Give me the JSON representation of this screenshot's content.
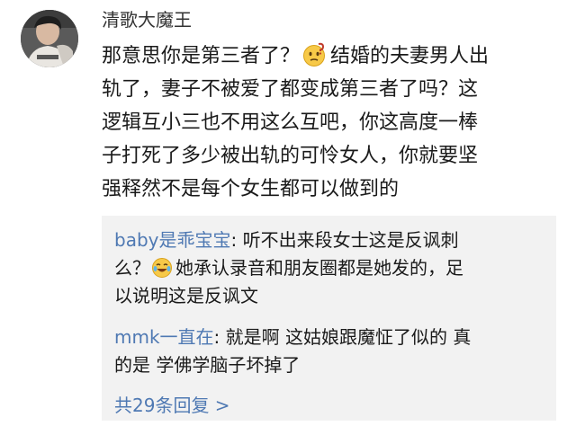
{
  "comment": {
    "username": "清歌大魔王",
    "lines": [
      {
        "before": "那意思你是第三者了？",
        "emoji": "thinking-face-emoji",
        "after": "结婚的夫妻男人出"
      },
      {
        "text": "轨了，妻子不被爱了都变成第三者了吗？这"
      },
      {
        "text": "逻辑互小三也不用这么互吧，你这高度一棒"
      },
      {
        "text": "子打死了多少被出轨的可怜女人，你就要坚"
      },
      {
        "text": "强释然不是每个女生都可以做到的"
      }
    ]
  },
  "replies": [
    {
      "user": "baby是乖宝宝",
      "line1_text": ": 听不出来段女士这是反讽刺",
      "line2_before": "么？",
      "line2_emoji": "laughing-tears-emoji",
      "line2_after": "她承认录音和朋友圈都是她发的，足",
      "line3": "以说明这是反讽文"
    },
    {
      "user": "mmk一直在",
      "line1_text": ": 就是啊 这姑娘跟魔怔了似的  真",
      "line2": "的是 学佛学脑子坏掉了"
    }
  ],
  "reply_count_label": "共29条回复 >",
  "colors": {
    "link": "#4f79b3",
    "text": "#1a1a1a",
    "reply_bg": "#f2f2f2"
  }
}
